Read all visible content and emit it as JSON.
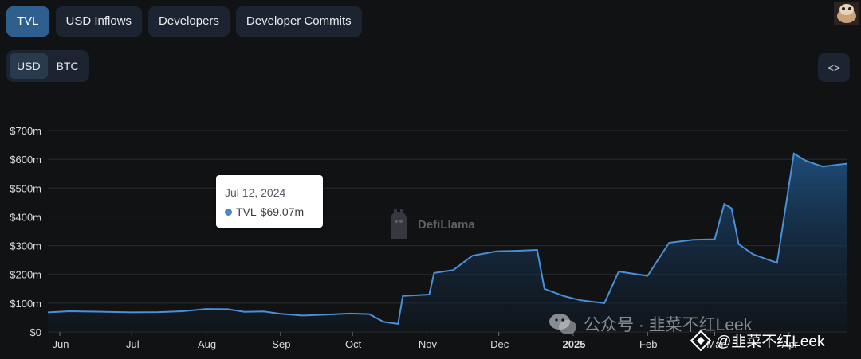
{
  "tabs": [
    "TVL",
    "USD Inflows",
    "Developers",
    "Developer Commits"
  ],
  "active_tab": "TVL",
  "currency_toggle": {
    "options": [
      "USD",
      "BTC"
    ],
    "selected": "USD"
  },
  "embed_button": {
    "icon": "code-embed-icon",
    "label": "<>"
  },
  "colors": {
    "line": "#4a90d9",
    "area_top": "#1f4f7f",
    "background": "#111213",
    "accent_tab": "#2f5f8f"
  },
  "chart_data": {
    "type": "area",
    "series": [
      {
        "name": "TVL",
        "x": [
          "2024-05-27",
          "2024-06-05",
          "2024-06-20",
          "2024-07-01",
          "2024-07-12",
          "2024-07-22",
          "2024-08-01",
          "2024-08-10",
          "2024-08-17",
          "2024-08-25",
          "2024-09-01",
          "2024-09-10",
          "2024-09-20",
          "2024-09-30",
          "2024-10-08",
          "2024-10-14",
          "2024-10-20",
          "2024-10-22",
          "2024-11-02",
          "2024-11-04",
          "2024-11-12",
          "2024-11-20",
          "2024-11-30",
          "2024-12-08",
          "2024-12-17",
          "2024-12-20",
          "2024-12-28",
          "2025-01-04",
          "2025-01-14",
          "2025-01-20",
          "2025-02-01",
          "2025-02-10",
          "2025-02-20",
          "2025-03-01",
          "2025-03-05",
          "2025-03-08",
          "2025-03-11",
          "2025-03-17",
          "2025-03-27",
          "2025-04-03",
          "2025-04-08",
          "2025-04-15",
          "2025-04-25"
        ],
        "values": [
          68,
          72,
          70,
          68,
          69,
          72,
          80,
          79,
          70,
          71,
          63,
          57,
          60,
          64,
          62,
          35,
          28,
          125,
          130,
          205,
          215,
          265,
          280,
          282,
          285,
          150,
          125,
          110,
          100,
          210,
          195,
          310,
          320,
          322,
          445,
          430,
          305,
          270,
          240,
          620,
          595,
          575,
          585
        ]
      }
    ],
    "x_ticks": [
      {
        "label": "Jun",
        "date": "2024-06-01"
      },
      {
        "label": "Jul",
        "date": "2024-07-01"
      },
      {
        "label": "Aug",
        "date": "2024-08-01"
      },
      {
        "label": "Sep",
        "date": "2024-09-01"
      },
      {
        "label": "Oct",
        "date": "2024-10-01"
      },
      {
        "label": "Nov",
        "date": "2024-11-01"
      },
      {
        "label": "Dec",
        "date": "2024-12-01"
      },
      {
        "label": "2025",
        "date": "2025-01-01"
      },
      {
        "label": "Feb",
        "date": "2025-02-01"
      },
      {
        "label": "Mar",
        "date": "2025-03-01"
      },
      {
        "label": "Apr",
        "date": "2025-04-01"
      }
    ],
    "y_ticks": [
      {
        "label": "$0",
        "value": 0
      },
      {
        "label": "$100m",
        "value": 100
      },
      {
        "label": "$200m",
        "value": 200
      },
      {
        "label": "$300m",
        "value": 300
      },
      {
        "label": "$400m",
        "value": 400
      },
      {
        "label": "$500m",
        "value": 500
      },
      {
        "label": "$600m",
        "value": 600
      },
      {
        "label": "$700m",
        "value": 700
      }
    ],
    "xlim": [
      "2024-05-27",
      "2025-04-25"
    ],
    "ylim": [
      0,
      700
    ],
    "grid": true
  },
  "tooltip": {
    "date": "Jul 12, 2024",
    "series": "TVL",
    "value": "$69.07m"
  },
  "watermark": {
    "text": "DefiLlama"
  },
  "overlay": {
    "wechat_text": "公众号 · 韭菜不红Leek",
    "handle": "@韭菜不红Leek"
  }
}
